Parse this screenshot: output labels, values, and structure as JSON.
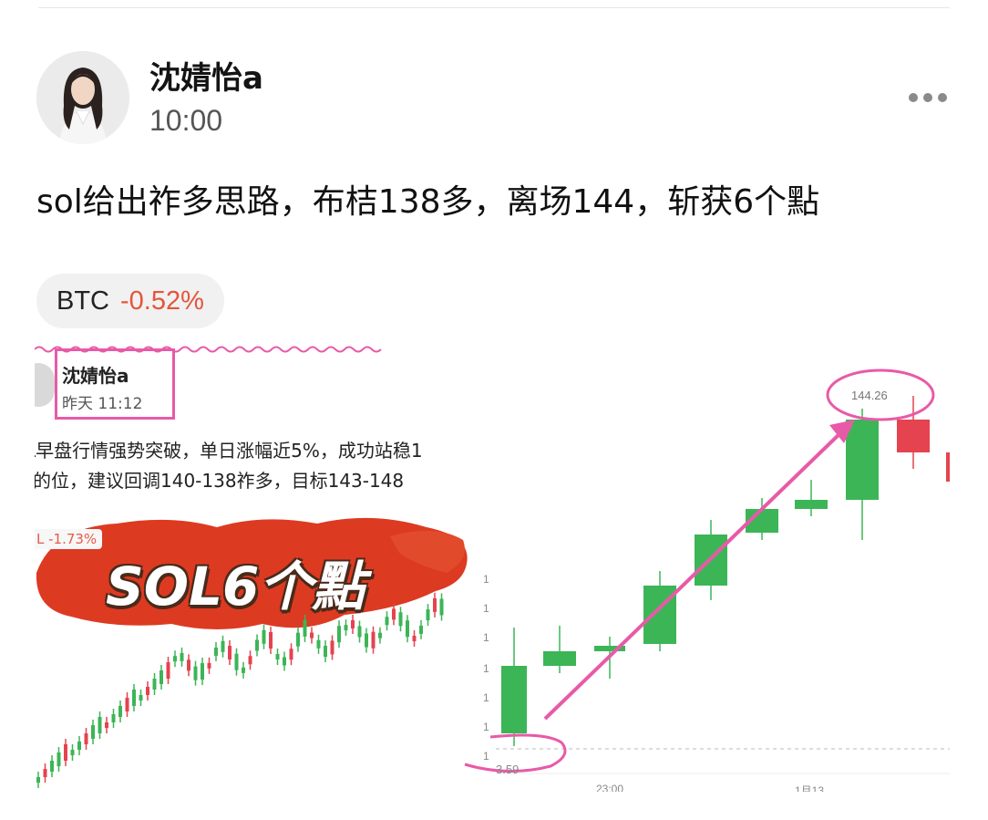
{
  "post": {
    "author": "沈婧怡a",
    "time": "10:00",
    "text": "sol给出祚多思路，布桔138多，离场144，斩获6个點",
    "more_icon": "more-horizontal-icon"
  },
  "ticker": {
    "symbol": "BTC",
    "change": "-0.52%",
    "change_color": "#e5553a"
  },
  "embedded_image": {
    "author": "沈婧怡a",
    "time": "昨天 11:12",
    "line1": "L早盘行情强势突破，单日涨幅近5%，成功站稳1",
    "line2": "的位，建议回调140-138祚多，目标143-148",
    "mini_ticker_change": "L -1.73%",
    "sticker": "SOL6个點",
    "price_high": "144.26",
    "price_low": "3.59",
    "time_label_1": "23:00",
    "time_label_2": "1月13",
    "axis_tick": "1",
    "up_color": "#3cb556",
    "down_color": "#e5434f",
    "annotation_color": "#e85aa8"
  }
}
